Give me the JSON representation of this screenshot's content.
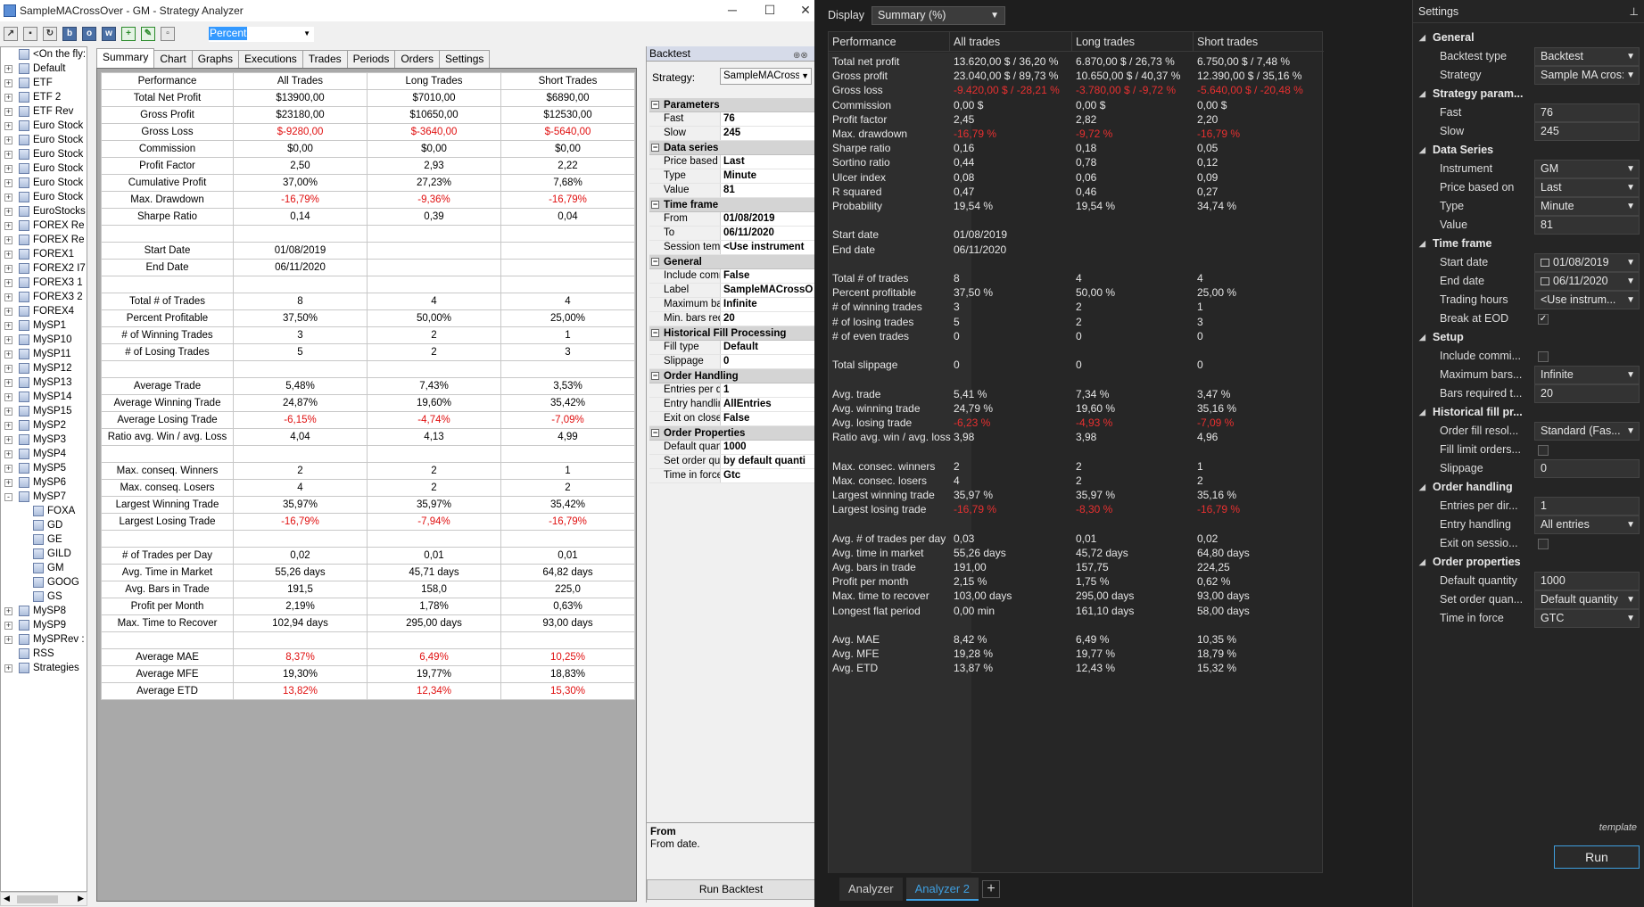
{
  "window": {
    "title": "SampleMACrossOver - GM - Strategy Analyzer"
  },
  "toolbar": {
    "display_mode": "Percent"
  },
  "tree": [
    {
      "label": "<On the fly:",
      "exp": ""
    },
    {
      "label": "Default",
      "exp": "+"
    },
    {
      "label": "ETF",
      "exp": "+"
    },
    {
      "label": "ETF 2",
      "exp": "+"
    },
    {
      "label": "ETF Rev",
      "exp": "+"
    },
    {
      "label": "Euro Stock",
      "exp": "+"
    },
    {
      "label": "Euro Stock",
      "exp": "+"
    },
    {
      "label": "Euro Stock",
      "exp": "+"
    },
    {
      "label": "Euro Stock",
      "exp": "+"
    },
    {
      "label": "Euro Stock",
      "exp": "+"
    },
    {
      "label": "Euro Stock",
      "exp": "+"
    },
    {
      "label": "EuroStocks",
      "exp": "+"
    },
    {
      "label": "FOREX Re",
      "exp": "+"
    },
    {
      "label": "FOREX Re",
      "exp": "+"
    },
    {
      "label": "FOREX1",
      "exp": "+"
    },
    {
      "label": "FOREX2 I7",
      "exp": "+"
    },
    {
      "label": "FOREX3 1",
      "exp": "+"
    },
    {
      "label": "FOREX3 2",
      "exp": "+"
    },
    {
      "label": "FOREX4",
      "exp": "+"
    },
    {
      "label": "MySP1",
      "exp": "+"
    },
    {
      "label": "MySP10",
      "exp": "+"
    },
    {
      "label": "MySP11",
      "exp": "+"
    },
    {
      "label": "MySP12",
      "exp": "+"
    },
    {
      "label": "MySP13",
      "exp": "+"
    },
    {
      "label": "MySP14",
      "exp": "+"
    },
    {
      "label": "MySP15",
      "exp": "+"
    },
    {
      "label": "MySP2",
      "exp": "+"
    },
    {
      "label": "MySP3",
      "exp": "+"
    },
    {
      "label": "MySP4",
      "exp": "+"
    },
    {
      "label": "MySP5",
      "exp": "+"
    },
    {
      "label": "MySP6",
      "exp": "+"
    },
    {
      "label": "MySP7",
      "exp": "-"
    },
    {
      "label": "FOXA",
      "exp": "",
      "child": true
    },
    {
      "label": "GD",
      "exp": "",
      "child": true
    },
    {
      "label": "GE",
      "exp": "",
      "child": true
    },
    {
      "label": "GILD",
      "exp": "",
      "child": true
    },
    {
      "label": "GM",
      "exp": "",
      "child": true
    },
    {
      "label": "GOOG",
      "exp": "",
      "child": true
    },
    {
      "label": "GS",
      "exp": "",
      "child": true
    },
    {
      "label": "MySP8",
      "exp": "+"
    },
    {
      "label": "MySP9",
      "exp": "+"
    },
    {
      "label": "MySPRev :",
      "exp": "+"
    },
    {
      "label": "RSS",
      "exp": ""
    },
    {
      "label": "Strategies",
      "exp": "+"
    }
  ],
  "tabs": [
    "Summary",
    "Chart",
    "Graphs",
    "Executions",
    "Trades",
    "Periods",
    "Orders",
    "Settings"
  ],
  "grid": {
    "headers": [
      "Performance",
      "All Trades",
      "Long Trades",
      "Short Trades"
    ],
    "rows": [
      [
        "Total Net Profit",
        "$13900,00",
        "$7010,00",
        "$6890,00"
      ],
      [
        "Gross Profit",
        "$23180,00",
        "$10650,00",
        "$12530,00"
      ],
      [
        "Gross Loss",
        "$-9280,00",
        "$-3640,00",
        "$-5640,00"
      ],
      [
        "Commission",
        "$0,00",
        "$0,00",
        "$0,00"
      ],
      [
        "Profit Factor",
        "2,50",
        "2,93",
        "2,22"
      ],
      [
        "Cumulative Profit",
        "37,00%",
        "27,23%",
        "7,68%"
      ],
      [
        "Max. Drawdown",
        "-16,79%",
        "-9,36%",
        "-16,79%"
      ],
      [
        "Sharpe Ratio",
        "0,14",
        "0,39",
        "0,04"
      ],
      [
        "",
        "",
        "",
        ""
      ],
      [
        "Start Date",
        "01/08/2019",
        "",
        ""
      ],
      [
        "End Date",
        "06/11/2020",
        "",
        ""
      ],
      [
        "",
        "",
        "",
        ""
      ],
      [
        "Total # of Trades",
        "8",
        "4",
        "4"
      ],
      [
        "Percent Profitable",
        "37,50%",
        "50,00%",
        "25,00%"
      ],
      [
        "# of Winning Trades",
        "3",
        "2",
        "1"
      ],
      [
        "# of Losing Trades",
        "5",
        "2",
        "3"
      ],
      [
        "",
        "",
        "",
        ""
      ],
      [
        "Average Trade",
        "5,48%",
        "7,43%",
        "3,53%"
      ],
      [
        "Average Winning Trade",
        "24,87%",
        "19,60%",
        "35,42%"
      ],
      [
        "Average Losing Trade",
        "-6,15%",
        "-4,74%",
        "-7,09%"
      ],
      [
        "Ratio avg. Win / avg. Loss",
        "4,04",
        "4,13",
        "4,99"
      ],
      [
        "",
        "",
        "",
        ""
      ],
      [
        "Max. conseq. Winners",
        "2",
        "2",
        "1"
      ],
      [
        "Max. conseq. Losers",
        "4",
        "2",
        "2"
      ],
      [
        "Largest Winning Trade",
        "35,97%",
        "35,97%",
        "35,42%"
      ],
      [
        "Largest Losing Trade",
        "-16,79%",
        "-7,94%",
        "-16,79%"
      ],
      [
        "",
        "",
        "",
        ""
      ],
      [
        "# of Trades per Day",
        "0,02",
        "0,01",
        "0,01"
      ],
      [
        "Avg. Time in Market",
        "55,26 days",
        "45,71 days",
        "64,82 days"
      ],
      [
        "Avg. Bars in Trade",
        "191,5",
        "158,0",
        "225,0"
      ],
      [
        "Profit per Month",
        "2,19%",
        "1,78%",
        "0,63%"
      ],
      [
        "Max. Time to Recover",
        "102,94 days",
        "295,00 days",
        "93,00 days"
      ],
      [
        "",
        "",
        "",
        ""
      ],
      [
        "Average MAE",
        "8,37%",
        "6,49%",
        "10,25%"
      ],
      [
        "Average MFE",
        "19,30%",
        "19,77%",
        "18,83%"
      ],
      [
        "Average ETD",
        "13,82%",
        "12,34%",
        "15,30%"
      ]
    ],
    "negative_rows": [
      2,
      6,
      19,
      25,
      33,
      35
    ]
  },
  "backtest": {
    "header": "Backtest",
    "strategy_label": "Strategy:",
    "strategy_value": "SampleMACrossO",
    "groups": [
      {
        "name": "Parameters",
        "rows": [
          [
            "Fast",
            "76"
          ],
          [
            "Slow",
            "245"
          ]
        ]
      },
      {
        "name": "Data series",
        "rows": [
          [
            "Price based or",
            "Last"
          ],
          [
            "Type",
            "Minute"
          ],
          [
            "Value",
            "81"
          ]
        ]
      },
      {
        "name": "Time frame",
        "rows": [
          [
            "From",
            "01/08/2019"
          ],
          [
            "To",
            "06/11/2020"
          ],
          [
            "Session templ",
            "<Use instrument"
          ]
        ]
      },
      {
        "name": "General",
        "rows": [
          [
            "Include commi",
            "False"
          ],
          [
            "Label",
            "SampleMACrossO"
          ],
          [
            "Maximum bars",
            "Infinite"
          ],
          [
            "Min. bars requ",
            "20"
          ]
        ]
      },
      {
        "name": "Historical Fill Processing",
        "rows": [
          [
            "Fill type",
            "Default"
          ],
          [
            "Slippage",
            "0"
          ]
        ]
      },
      {
        "name": "Order Handling",
        "rows": [
          [
            "Entries per dir",
            "1"
          ],
          [
            "Entry handling",
            "AllEntries"
          ],
          [
            "Exit on close",
            "False"
          ]
        ]
      },
      {
        "name": "Order Properties",
        "rows": [
          [
            "Default quantit",
            "1000"
          ],
          [
            "Set order quan",
            "by default quanti"
          ],
          [
            "Time in force",
            "Gtc"
          ]
        ]
      }
    ],
    "desc_title": "From",
    "desc_text": "From date.",
    "run_label": "Run Backtest"
  },
  "dark": {
    "display_label": "Display",
    "display_value": "Summary (%)",
    "headers": [
      "Performance",
      "All trades",
      "Long trades",
      "Short trades"
    ],
    "rows": [
      [
        "Total net profit",
        "13.620,00 $ / 36,20 %",
        "6.870,00 $ / 26,73 %",
        "6.750,00 $ / 7,48 %"
      ],
      [
        "Gross profit",
        "23.040,00 $ / 89,73 %",
        "10.650,00 $ / 40,37 %",
        "12.390,00 $ / 35,16 %"
      ],
      [
        "Gross loss",
        "-9.420,00 $ / -28,21 %",
        "-3.780,00 $ / -9,72 %",
        "-5.640,00 $ / -20,48 %"
      ],
      [
        "Commission",
        "0,00 $",
        "0,00 $",
        "0,00 $"
      ],
      [
        "Profit factor",
        "2,45",
        "2,82",
        "2,20"
      ],
      [
        "Max. drawdown",
        "-16,79 %",
        "-9,72 %",
        "-16,79 %"
      ],
      [
        "Sharpe ratio",
        "0,16",
        "0,18",
        "0,05"
      ],
      [
        "Sortino ratio",
        "0,44",
        "0,78",
        "0,12"
      ],
      [
        "Ulcer index",
        "0,08",
        "0,06",
        "0,09"
      ],
      [
        "R squared",
        "0,47",
        "0,46",
        "0,27"
      ],
      [
        "Probability",
        "19,54 %",
        "19,54 %",
        "34,74 %"
      ],
      [
        "",
        "",
        "",
        ""
      ],
      [
        "Start date",
        "01/08/2019",
        "",
        ""
      ],
      [
        "End date",
        "06/11/2020",
        "",
        ""
      ],
      [
        "",
        "",
        "",
        ""
      ],
      [
        "Total # of trades",
        "8",
        "4",
        "4"
      ],
      [
        "Percent profitable",
        "37,50 %",
        "50,00 %",
        "25,00 %"
      ],
      [
        "# of winning trades",
        "3",
        "2",
        "1"
      ],
      [
        "# of losing trades",
        "5",
        "2",
        "3"
      ],
      [
        "# of even trades",
        "0",
        "0",
        "0"
      ],
      [
        "",
        "",
        "",
        ""
      ],
      [
        "Total slippage",
        "0",
        "0",
        "0"
      ],
      [
        "",
        "",
        "",
        ""
      ],
      [
        "Avg. trade",
        "5,41 %",
        "7,34 %",
        "3,47 %"
      ],
      [
        "Avg. winning trade",
        "24,79 %",
        "19,60 %",
        "35,16 %"
      ],
      [
        "Avg. losing trade",
        "-6,23 %",
        "-4,93 %",
        "-7,09 %"
      ],
      [
        "Ratio avg. win / avg. loss",
        "3,98",
        "3,98",
        "4,96"
      ],
      [
        "",
        "",
        "",
        ""
      ],
      [
        "Max. consec. winners",
        "2",
        "2",
        "1"
      ],
      [
        "Max. consec. losers",
        "4",
        "2",
        "2"
      ],
      [
        "Largest winning trade",
        "35,97 %",
        "35,97 %",
        "35,16 %"
      ],
      [
        "Largest losing trade",
        "-16,79 %",
        "-8,30 %",
        "-16,79 %"
      ],
      [
        "",
        "",
        "",
        ""
      ],
      [
        "Avg. # of trades per day",
        "0,03",
        "0,01",
        "0,02"
      ],
      [
        "Avg. time in market",
        "55,26 days",
        "45,72 days",
        "64,80 days"
      ],
      [
        "Avg. bars in trade",
        "191,00",
        "157,75",
        "224,25"
      ],
      [
        "Profit per month",
        "2,15 %",
        "1,75 %",
        "0,62 %"
      ],
      [
        "Max. time to recover",
        "103,00 days",
        "295,00 days",
        "93,00 days"
      ],
      [
        "Longest flat period",
        "0,00 min",
        "161,10 days",
        "58,00 days"
      ],
      [
        "",
        "",
        "",
        ""
      ],
      [
        "Avg. MAE",
        "8,42 %",
        "6,49 %",
        "10,35 %"
      ],
      [
        "Avg. MFE",
        "19,28 %",
        "19,77 %",
        "18,79 %"
      ],
      [
        "Avg. ETD",
        "13,87 %",
        "12,43 %",
        "15,32 %"
      ]
    ],
    "negative_rows": [
      2,
      5,
      25,
      31
    ],
    "tabs": [
      "Analyzer",
      "Analyzer 2"
    ],
    "active_tab": 1,
    "add_tab": "+"
  },
  "settings": {
    "title": "Settings",
    "items": [
      {
        "cat": "General"
      },
      {
        "k": "Backtest type",
        "v": "Backtest",
        "dd": true
      },
      {
        "k": "Strategy",
        "v": "Sample MA cros:",
        "dd": true
      },
      {
        "cat": "Strategy param..."
      },
      {
        "k": "Fast",
        "v": "76"
      },
      {
        "k": "Slow",
        "v": "245"
      },
      {
        "cat": "Data Series"
      },
      {
        "k": "Instrument",
        "v": "GM",
        "dd": true
      },
      {
        "k": "Price based on",
        "v": "Last",
        "dd": true
      },
      {
        "k": "Type",
        "v": "Minute",
        "dd": true
      },
      {
        "k": "Value",
        "v": "81"
      },
      {
        "cat": "Time frame"
      },
      {
        "k": "Start date",
        "v": "01/08/2019",
        "dd": true,
        "cal": true
      },
      {
        "k": "End date",
        "v": "06/11/2020",
        "dd": true,
        "cal": true
      },
      {
        "k": "Trading hours",
        "v": "<Use instrum...",
        "dd": true
      },
      {
        "k": "Break at EOD",
        "check": true,
        "checked": true
      },
      {
        "cat": "Setup"
      },
      {
        "k": "Include commi...",
        "check": true,
        "checked": false
      },
      {
        "k": "Maximum bars...",
        "v": "Infinite",
        "dd": true
      },
      {
        "k": "Bars required t...",
        "v": "20"
      },
      {
        "cat": "Historical fill pr..."
      },
      {
        "k": "Order fill resol...",
        "v": "Standard (Fas...",
        "dd": true
      },
      {
        "k": "Fill limit orders...",
        "check": true,
        "checked": false
      },
      {
        "k": "Slippage",
        "v": "0"
      },
      {
        "cat": "Order handling"
      },
      {
        "k": "Entries per dir...",
        "v": "1"
      },
      {
        "k": "Entry handling",
        "v": "All entries",
        "dd": true
      },
      {
        "k": "Exit on sessio...",
        "check": true,
        "checked": false
      },
      {
        "cat": "Order properties"
      },
      {
        "k": "Default quantity",
        "v": "1000"
      },
      {
        "k": "Set order quan...",
        "v": "Default quantity",
        "dd": true
      },
      {
        "k": "Time in force",
        "v": "GTC",
        "dd": true
      }
    ],
    "template_label": "template",
    "run_label": "Run"
  },
  "colors": {
    "negative_light": "#e01010",
    "negative_dark": "#e83030",
    "accent": "#3f9fe0"
  }
}
